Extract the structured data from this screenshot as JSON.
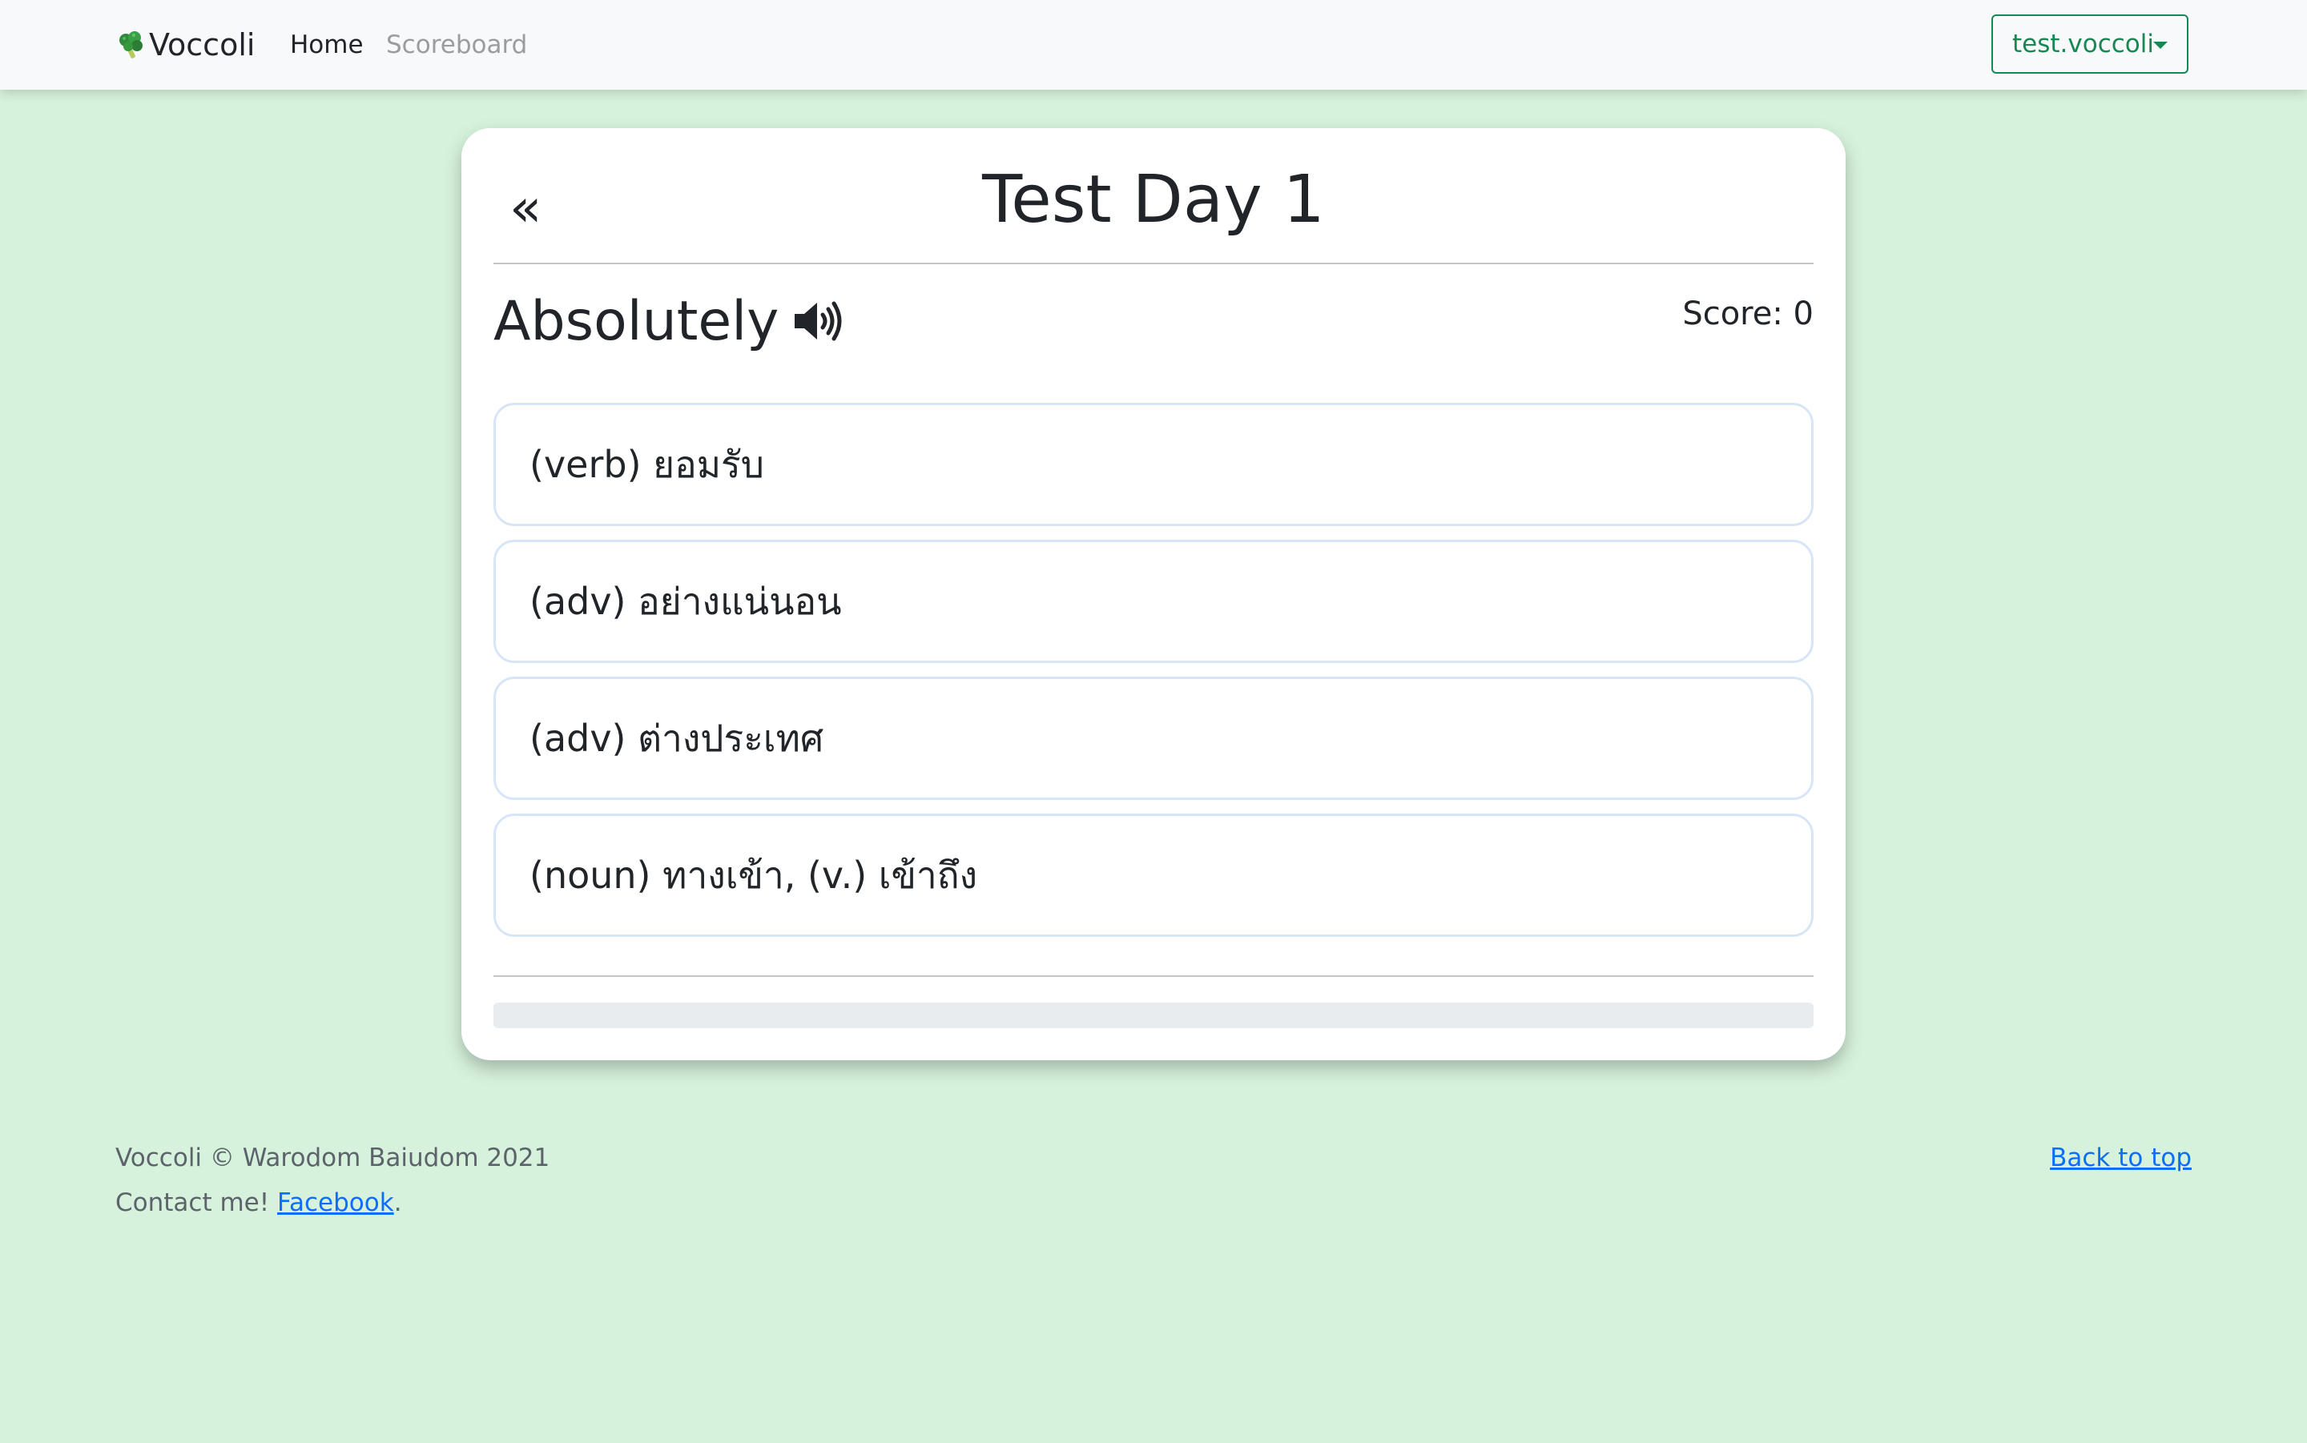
{
  "navbar": {
    "brand": "Voccoli",
    "brand_icon": "broccoli-icon",
    "links": [
      {
        "label": "Home",
        "active": true
      },
      {
        "label": "Scoreboard",
        "active": false
      }
    ],
    "user_menu": {
      "label": "test.voccoli",
      "icon": "caret-down-icon"
    }
  },
  "card": {
    "back_label": "«",
    "title": "Test Day 1",
    "word": "Absolutely",
    "speaker_icon": "speaker-icon",
    "score": "Score: 0",
    "choices": [
      "(verb) ยอมรับ",
      "(adv) อย่างแน่นอน",
      "(adv) ต่างประเทศ",
      "(noun) ทางเข้า, (v.) เข้าถึง"
    ],
    "progress": 0
  },
  "footer": {
    "copyright": "Voccoli © Warodom Baiudom 2021",
    "contact_prefix": "Contact me! ",
    "contact_link": "Facebook",
    "contact_suffix": ".",
    "back_to_top": "Back to top"
  },
  "colors": {
    "page_background": "#d6f2dc",
    "navbar_background": "#f8f9fa",
    "accent_green": "#198754",
    "link_blue": "#0d6efd",
    "choice_border": "#d7e6f7"
  }
}
